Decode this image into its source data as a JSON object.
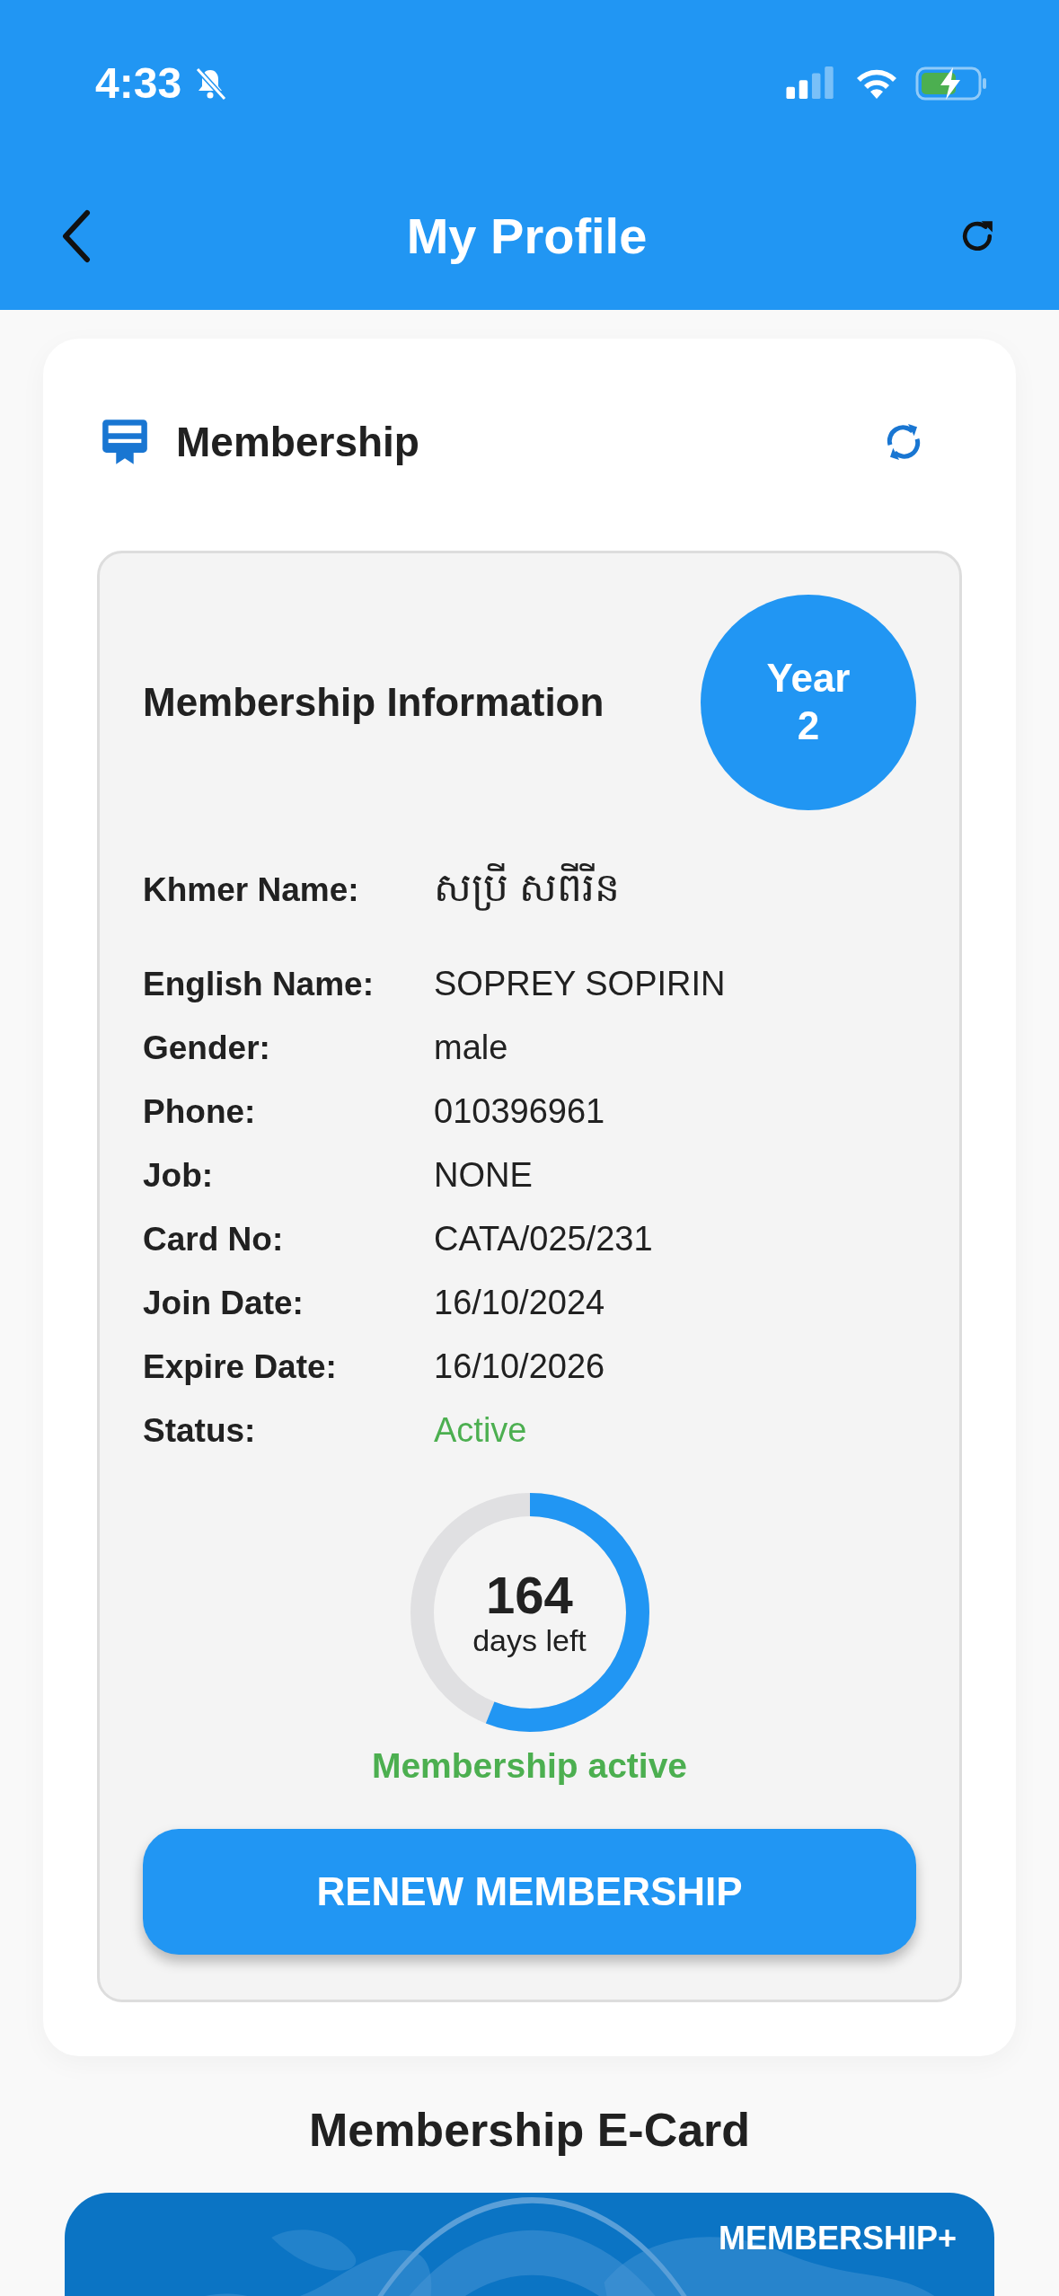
{
  "status_bar": {
    "time": "4:33"
  },
  "header": {
    "title": "My Profile"
  },
  "membership": {
    "title": "Membership",
    "info_title": "Membership Information",
    "year_badge": [
      "Year",
      "2"
    ],
    "fields": [
      {
        "label": "Khmer Name:",
        "value": "សប្រី សពីរីន",
        "kind": "khmer"
      },
      {
        "label": "English Name:",
        "value": "SOPREY SOPIRIN",
        "kind": "text"
      },
      {
        "label": "Gender:",
        "value": "male",
        "kind": "text"
      },
      {
        "label": "Phone:",
        "value": "010396961",
        "kind": "text"
      },
      {
        "label": "Job:",
        "value": "NONE",
        "kind": "text"
      },
      {
        "label": "Card No:",
        "value": "CATA/025/231",
        "kind": "text"
      },
      {
        "label": "Join Date:",
        "value": "16/10/2024",
        "kind": "text"
      },
      {
        "label": "Expire Date:",
        "value": "16/10/2026",
        "kind": "text"
      },
      {
        "label": "Status:",
        "value": "Active",
        "kind": "status"
      }
    ],
    "countdown": {
      "number": "164",
      "unit": "days left",
      "level": 0.56
    },
    "countdown_status": "Membership active",
    "renew_button": "RENEW MEMBERSHIP"
  },
  "ecard": {
    "title": "Membership E-Card",
    "badge": "MEMBERSHIP+"
  }
}
